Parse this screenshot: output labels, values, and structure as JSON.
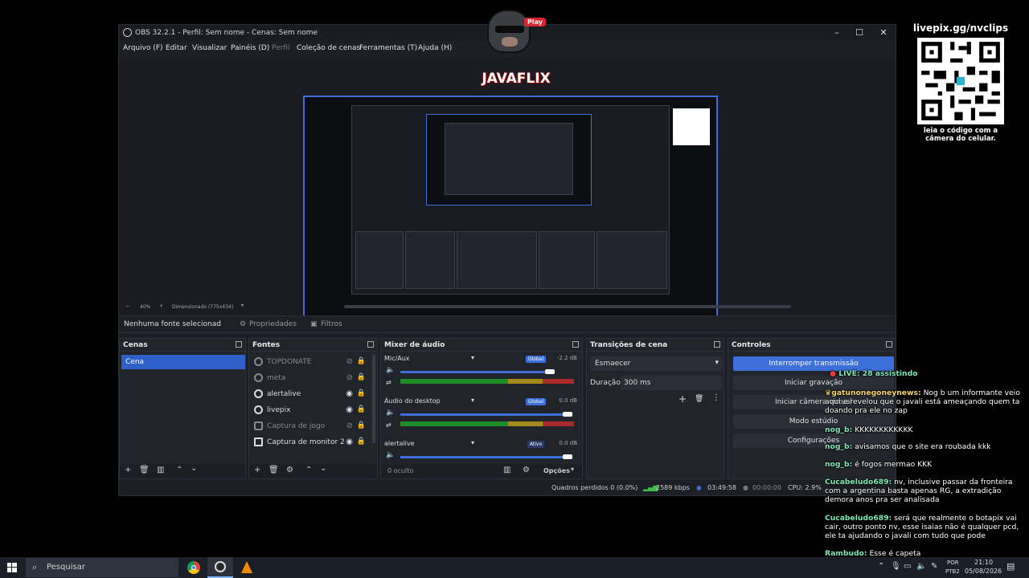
{
  "obs": {
    "title": "OBS 32.2.1 - Perfil: Sem nome - Cenas: Sem nome",
    "menu": [
      "Arquivo (F)",
      "Editar",
      "Visualizar",
      "Painéis (D)",
      "Perfil",
      "Coleção de cenas",
      "Ferramentas (T)",
      "Ajuda (H)"
    ],
    "zoom": "40%",
    "dimension": "Dimensionado (775x434)",
    "no_source": "Nenhuma fonte selecionad",
    "properties": "Propriedades",
    "filters": "Filtros"
  },
  "scenes": {
    "header": "Cenas",
    "items": [
      "Cena"
    ]
  },
  "sources": {
    "header": "Fontes",
    "items": [
      {
        "name": "TOPDONATE",
        "visible": false
      },
      {
        "name": "meta",
        "visible": false
      },
      {
        "name": "alertalive",
        "visible": true
      },
      {
        "name": "livepix",
        "visible": true
      },
      {
        "name": "Captura de jogo",
        "visible": false
      },
      {
        "name": "Captura de monitor 2",
        "visible": true
      }
    ]
  },
  "mixer": {
    "header": "Mixer de áudio",
    "channels": [
      {
        "name": "Mic/Aux",
        "badge": "Global",
        "db": "-2.2 dB"
      },
      {
        "name": "Áudio do desktop",
        "badge": "Global",
        "db": "0.0 dB"
      },
      {
        "name": "alertalive",
        "badge": "Ativo",
        "db": "0.0 dB"
      }
    ],
    "scale": [
      "-60",
      "-55",
      "-50",
      "-45",
      "-40",
      "-35",
      "-30",
      "-25",
      "-20",
      "-15",
      "-10",
      "-5",
      "0"
    ],
    "hidden": "0 oculto",
    "options": "Opções"
  },
  "transitions": {
    "header": "Transições de cena",
    "type": "Esmaecer",
    "duration_label": "Duração",
    "duration": "300 ms"
  },
  "controls": {
    "header": "Controles",
    "buttons": [
      "Interromper transmissão",
      "Iniciar gravação",
      "Iniciar câmera virtual",
      "Modo estúdio",
      "Configurações"
    ]
  },
  "status": {
    "dropped": "Quadros perdidos 0 (0.0%)",
    "bitrate": "2589 kbps",
    "stream_time": "03:49:58",
    "rec_time": "00:00:00",
    "cpu": "CPU: 2.9%"
  },
  "overlay": {
    "brand": "JAVAFLIX",
    "brand_tag": "Play",
    "livepix_url": "livepix.gg/nvclips",
    "qr_caption": "leia o código com a câmera do celular."
  },
  "chat": {
    "live": "LIVE: 28 assistindo",
    "messages": [
      {
        "user": "gatunonegoneynews:",
        "text": "Nog b um informante veio aqui e revelou que o javali está ameaçando quem ta doando pra ele no zap"
      },
      {
        "user": "nog_b:",
        "text": "KKKKKKKKKKKK"
      },
      {
        "user": "nog_b:",
        "text": "avisamos que o site era roubada kkk"
      },
      {
        "user": "nog_b:",
        "text": "é fogos mermao KKK"
      },
      {
        "user": "Cucabeludo689:",
        "text": "nv, inclusive passar da fronteira com a argentina basta apenas RG, a extradição demora anos pra ser analisada"
      },
      {
        "user": "Cucabeludo689:",
        "text": "será que realmente o botapix vai cair, outro ponto nv, esse isaias não é qualquer pcd, ele ta ajudando o javali com tudo que pode"
      },
      {
        "user": "Rambudo:",
        "text": "Esse é capeta"
      }
    ]
  },
  "taskbar": {
    "search": "Pesquisar",
    "lang": "POR",
    "layout": "PTB2",
    "time": "21:10",
    "date": "05/08/2026"
  },
  "colors": {
    "accent": "#3d6fd8",
    "live_dot": "#e53935",
    "chat_user": "#7fe8b5"
  }
}
